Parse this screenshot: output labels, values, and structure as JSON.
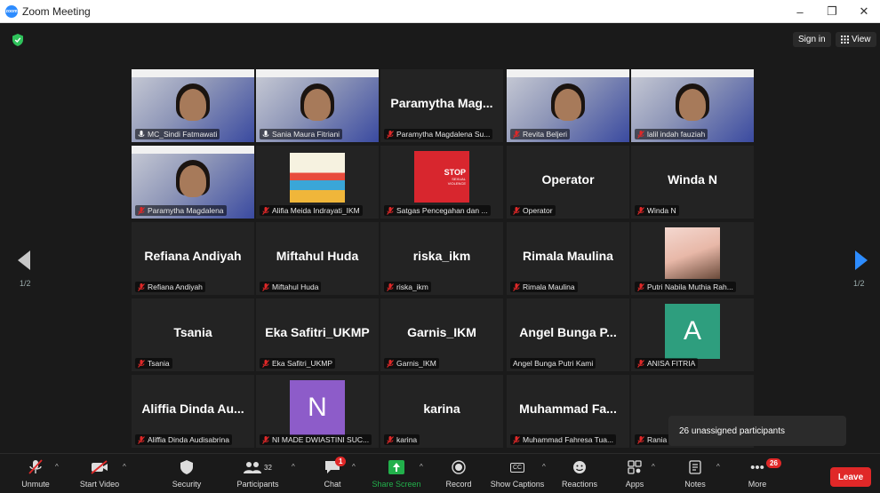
{
  "window": {
    "title": "Zoom Meeting",
    "logo_text": "zoom"
  },
  "window_controls": {
    "minimize": "–",
    "restore": "❐",
    "close": "✕"
  },
  "top_right": {
    "sign_in": "Sign in",
    "view": "View"
  },
  "page_indicator": {
    "left": "1/2",
    "right": "1/2"
  },
  "tiles": [
    {
      "kind": "video",
      "label": "MC_Sindi Fatmawati",
      "mic": "on",
      "active": true
    },
    {
      "kind": "video",
      "label": "Sania Maura Fitriani",
      "mic": "on"
    },
    {
      "kind": "name",
      "name": "Paramytha Mag...",
      "label": "Paramytha Magdalena Su...",
      "mic": "off"
    },
    {
      "kind": "video",
      "label": "Revita Beljeri",
      "mic": "off"
    },
    {
      "kind": "video",
      "label": "lalil indah fauziah",
      "mic": "off"
    },
    {
      "kind": "video",
      "label": "Paramytha Magdalena",
      "mic": "off"
    },
    {
      "kind": "image",
      "label": "Alifia Meida Indrayati_IKM",
      "mic": "off"
    },
    {
      "kind": "stop",
      "label": "Satgas Pencegahan dan ...",
      "mic": "off",
      "stop_text": "STOP",
      "stop_sub": "SEXUAL VIOLENCE"
    },
    {
      "kind": "name",
      "name": "Operator",
      "label": "Operator",
      "mic": "off"
    },
    {
      "kind": "name",
      "name": "Winda N",
      "label": "Winda N",
      "mic": "off"
    },
    {
      "kind": "name",
      "name": "Refiana Andiyah",
      "label": "Refiana Andiyah",
      "mic": "off"
    },
    {
      "kind": "name",
      "name": "Miftahul Huda",
      "label": "Miftahul Huda",
      "mic": "off"
    },
    {
      "kind": "name",
      "name": "riska_ikm",
      "label": "riska_ikm",
      "mic": "off"
    },
    {
      "kind": "name",
      "name": "Rimala Maulina",
      "label": "Rimala Maulina",
      "mic": "off"
    },
    {
      "kind": "photo",
      "label": "Putri Nabila Muthia Rah...",
      "mic": "off"
    },
    {
      "kind": "name",
      "name": "Tsania",
      "label": "Tsania",
      "mic": "off"
    },
    {
      "kind": "name",
      "name": "Eka Safitri_UKMP",
      "label": "Eka Safitri_UKMP",
      "mic": "off"
    },
    {
      "kind": "name",
      "name": "Garnis_IKM",
      "label": "Garnis_IKM",
      "mic": "off"
    },
    {
      "kind": "name",
      "name": "Angel Bunga P...",
      "label": "Angel Bunga Putri Kami",
      "mic": "none"
    },
    {
      "kind": "avatar",
      "avatar_letter": "A",
      "avatar_color": "#2e9e7e",
      "label": "ANISA FITRIA",
      "mic": "off"
    },
    {
      "kind": "name",
      "name": "Aliffia Dinda Au...",
      "label": "Aliffia Dinda Audisabrina",
      "mic": "off"
    },
    {
      "kind": "avatar",
      "avatar_letter": "N",
      "avatar_color": "#8d5cc9",
      "label": "NI MADE DWIASTINI SUC...",
      "mic": "off"
    },
    {
      "kind": "name",
      "name": "karina",
      "label": "karina",
      "mic": "off"
    },
    {
      "kind": "name",
      "name": "Muhammad Fa...",
      "label": "Muhammad Fahresa Tua...",
      "mic": "off"
    },
    {
      "kind": "name",
      "name": "",
      "label": "Rania",
      "mic": "off"
    }
  ],
  "tooltip": {
    "text": "26 unassigned participants"
  },
  "toolbar": {
    "unmute": "Unmute",
    "start_video": "Start Video",
    "security": "Security",
    "participants": "Participants",
    "participants_count": "32",
    "chat": "Chat",
    "chat_badge": "1",
    "share_screen": "Share Screen",
    "record": "Record",
    "show_captions": "Show Captions",
    "captions_icon": "CC",
    "reactions": "Reactions",
    "apps": "Apps",
    "notes": "Notes",
    "more": "More",
    "more_badge": "26",
    "more_icon": "•••",
    "leave": "Leave"
  },
  "colors": {
    "accent_green": "#2fc25b",
    "share_green": "#22b04b",
    "leave_red": "#e02828",
    "badge_red": "#e02828",
    "active_outline": "#d6e36a"
  }
}
